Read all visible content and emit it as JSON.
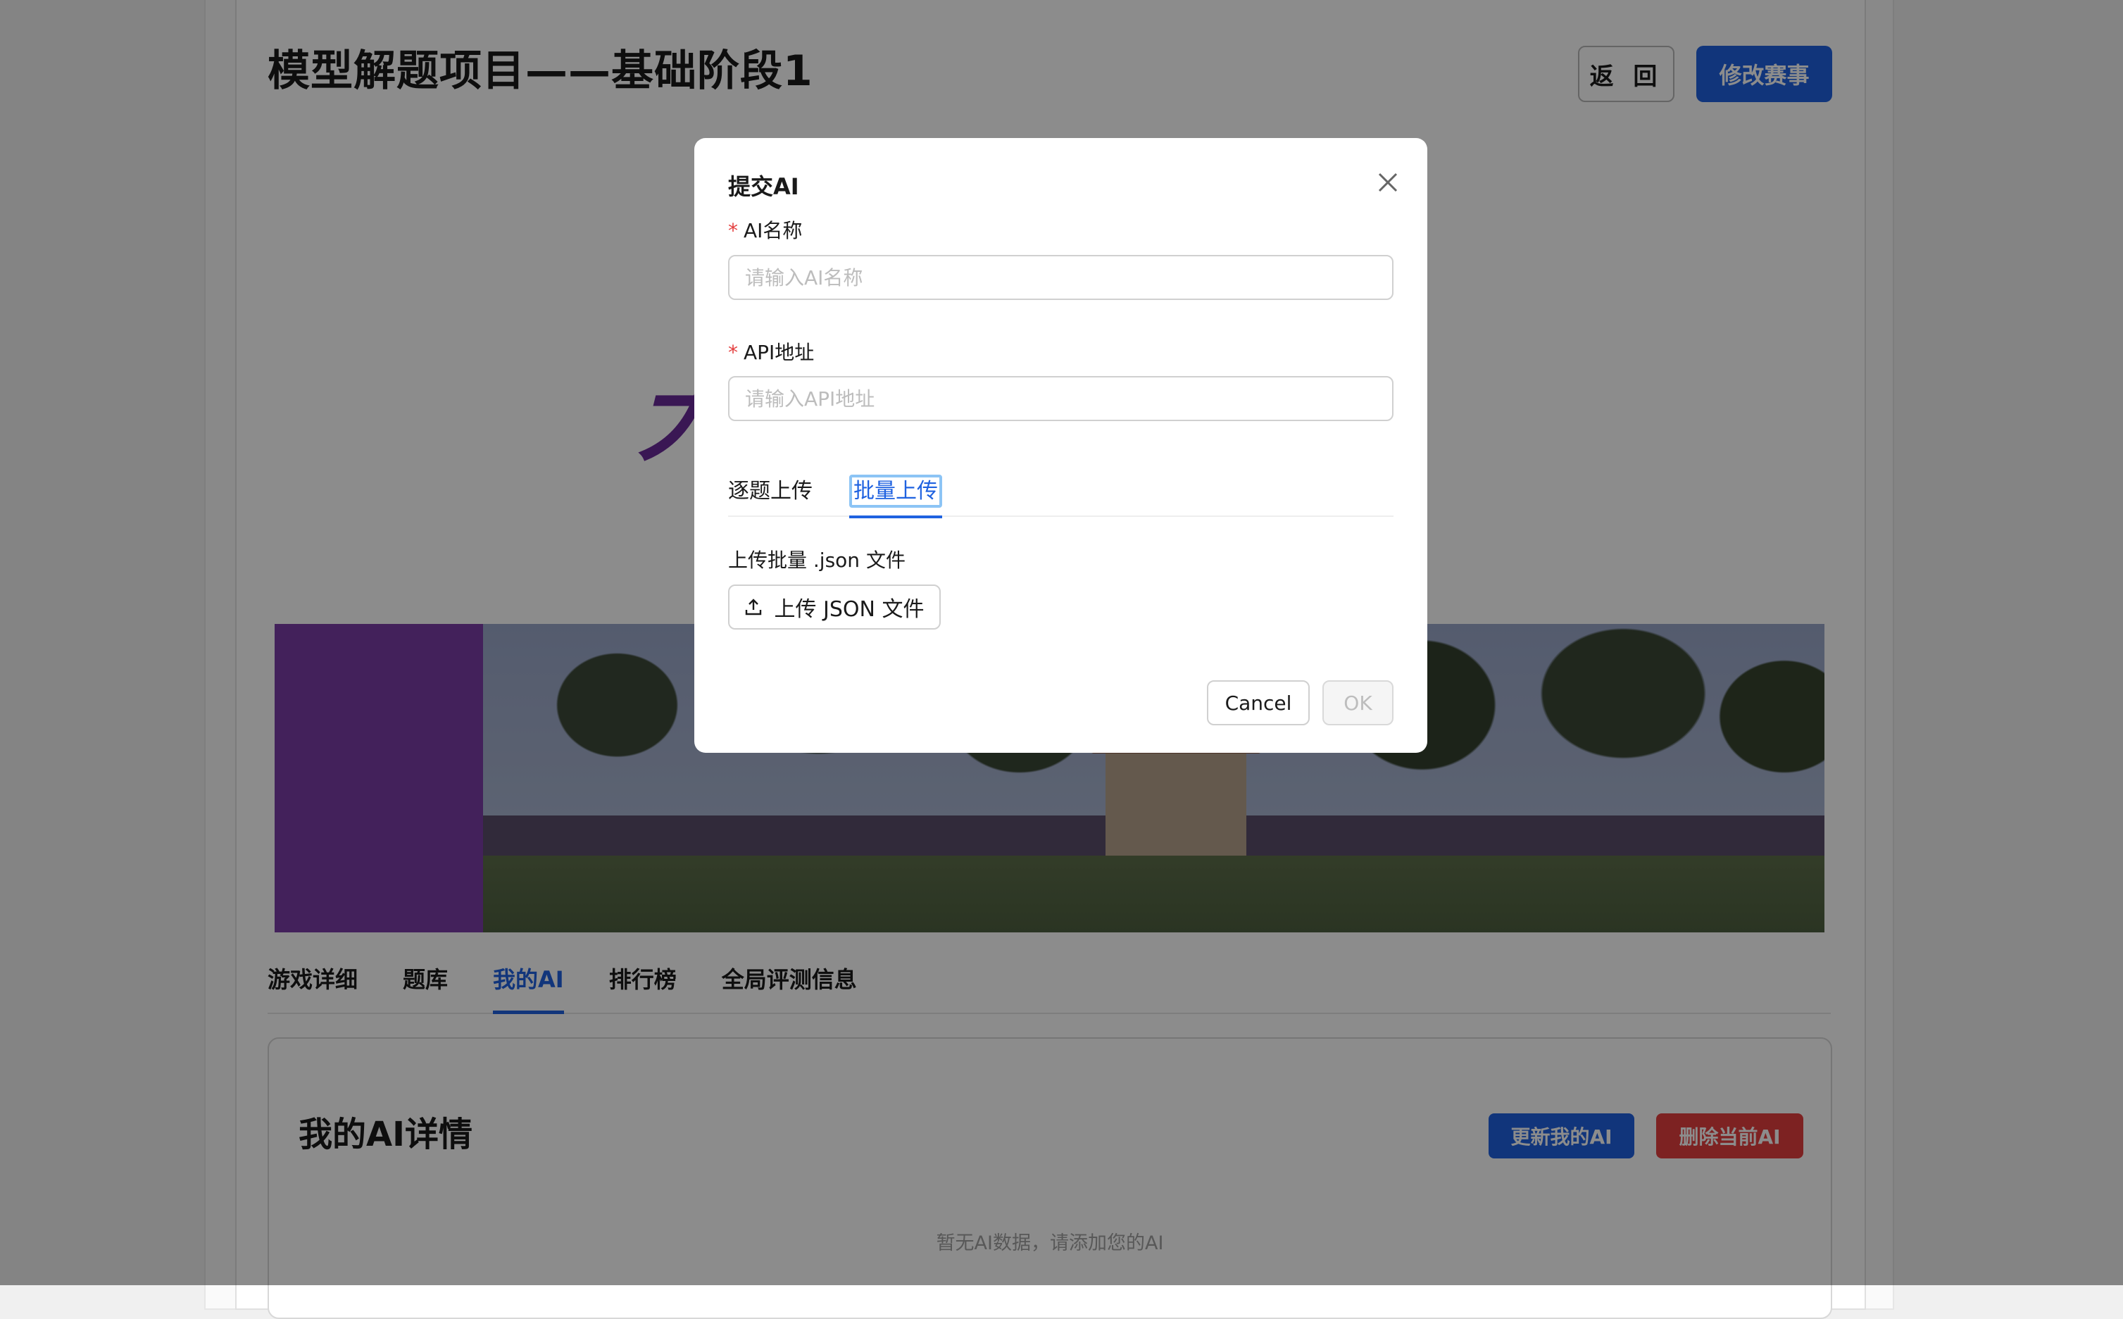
{
  "page": {
    "title": "模型解题项目——基础阶段1",
    "back_label": "返 回",
    "edit_label": "修改赛事",
    "logo_char": "大"
  },
  "tabs": [
    {
      "label": "游戏详细",
      "active": false
    },
    {
      "label": "题库",
      "active": false
    },
    {
      "label": "我的AI",
      "active": true
    },
    {
      "label": "排行榜",
      "active": false
    },
    {
      "label": "全局评测信息",
      "active": false
    }
  ],
  "ai_detail": {
    "title": "我的AI详情",
    "update_label": "更新我的AI",
    "delete_label": "删除当前AI",
    "empty_text": "暂无AI数据，请添加您的AI"
  },
  "modal": {
    "title": "提交AI",
    "name_field": {
      "label": "AI名称",
      "placeholder": "请输入AI名称",
      "value": ""
    },
    "api_field": {
      "label": "API地址",
      "placeholder": "请输入API地址",
      "value": ""
    },
    "tabs": [
      {
        "label": "逐题上传",
        "active": false
      },
      {
        "label": "批量上传",
        "active": true
      }
    ],
    "upload_label": "上传批量 .json 文件",
    "upload_button": "上传 JSON 文件",
    "cancel_label": "Cancel",
    "ok_label": "OK"
  },
  "colors": {
    "primary": "#1f62e0",
    "danger": "#e43f3f",
    "brand_purple": "#7b3da6"
  }
}
